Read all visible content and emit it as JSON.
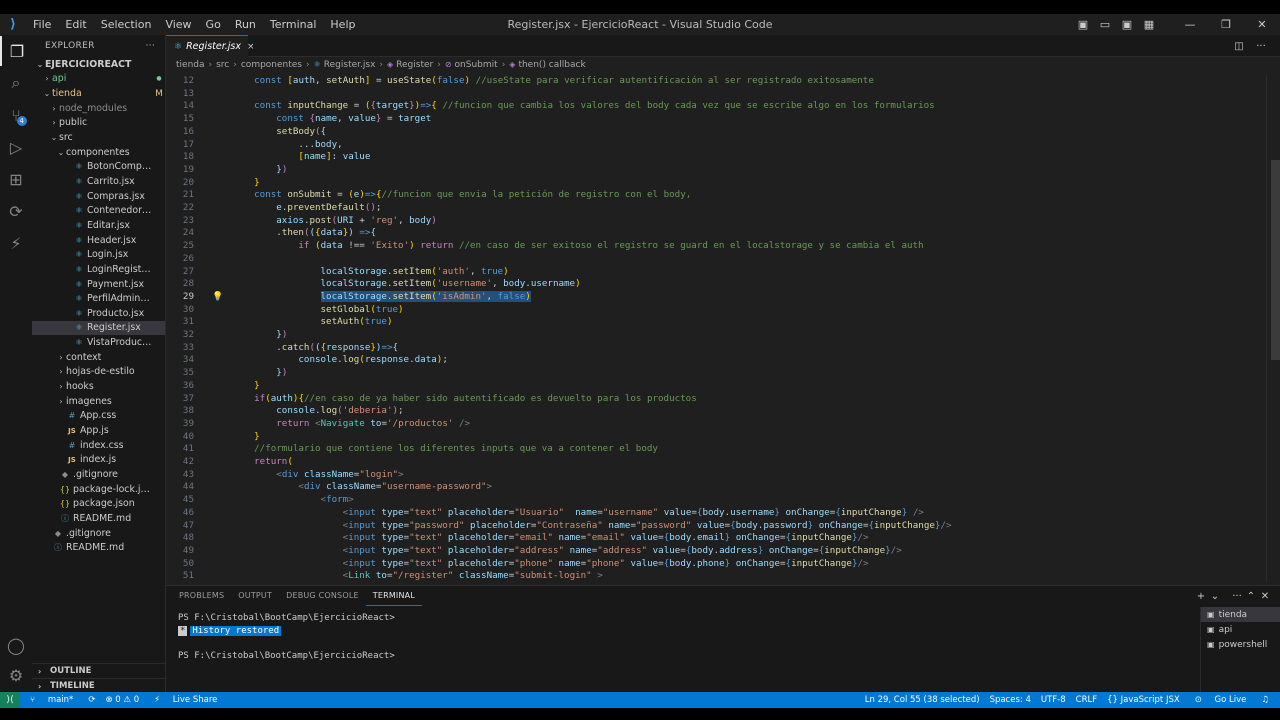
{
  "window": {
    "title": "Register.jsx - EjercicioReact - Visual Studio Code",
    "menu": [
      "File",
      "Edit",
      "Selection",
      "View",
      "Go",
      "Run",
      "Terminal",
      "Help"
    ]
  },
  "colors": {
    "accent": "#0078d4",
    "remote": "#16825d",
    "selection": "#264f78",
    "react_icon": "#4fc1e9"
  },
  "activity_bar": {
    "icons": [
      "explorer-icon",
      "search-icon",
      "source-control-icon",
      "run-debug-icon",
      "extensions-icon",
      "remote-explorer-icon",
      "live-share-icon",
      "accounts-icon",
      "manage-icon"
    ],
    "source_control_badge": "4"
  },
  "explorer": {
    "header": "EXPLORER",
    "more": "···",
    "tree": [
      {
        "label": "EJERCICIOREACT",
        "type": "root",
        "status": ""
      },
      {
        "label": "api",
        "type": "folder",
        "status": "●"
      },
      {
        "label": "tienda",
        "type": "folder-open",
        "status": "M"
      },
      {
        "label": "node_modules",
        "type": "folder",
        "status": ""
      },
      {
        "label": "public",
        "type": "folder",
        "status": ""
      },
      {
        "label": "src",
        "type": "folder-open",
        "status": ""
      },
      {
        "label": "componentes",
        "type": "folder-open",
        "status": ""
      },
      {
        "label": "BotonComprar.jsx",
        "type": "react",
        "status": ""
      },
      {
        "label": "Carrito.jsx",
        "type": "react",
        "status": ""
      },
      {
        "label": "Compras.jsx",
        "type": "react",
        "status": ""
      },
      {
        "label": "ContenedorProductos.j...",
        "type": "react",
        "status": ""
      },
      {
        "label": "Editar.jsx",
        "type": "react",
        "status": ""
      },
      {
        "label": "Header.jsx",
        "type": "react",
        "status": ""
      },
      {
        "label": "Login.jsx",
        "type": "react",
        "status": ""
      },
      {
        "label": "LoginRegisterProfile.jsx",
        "type": "react",
        "status": ""
      },
      {
        "label": "Payment.jsx",
        "type": "react",
        "status": ""
      },
      {
        "label": "PerfilAdmin.jsx",
        "type": "react",
        "status": ""
      },
      {
        "label": "Producto.jsx",
        "type": "react",
        "status": ""
      },
      {
        "label": "Register.jsx",
        "type": "react",
        "status": ""
      },
      {
        "label": "VistaProducto.jsx",
        "type": "react",
        "status": ""
      },
      {
        "label": "context",
        "type": "folder",
        "status": ""
      },
      {
        "label": "hojas-de-estilo",
        "type": "folder",
        "status": ""
      },
      {
        "label": "hooks",
        "type": "folder",
        "status": ""
      },
      {
        "label": "imagenes",
        "type": "folder",
        "status": ""
      },
      {
        "label": "App.css",
        "type": "css",
        "status": ""
      },
      {
        "label": "App.js",
        "type": "js",
        "status": ""
      },
      {
        "label": "index.css",
        "type": "css",
        "status": ""
      },
      {
        "label": "index.js",
        "type": "js",
        "status": ""
      },
      {
        "label": ".gitignore",
        "type": "git",
        "status": ""
      },
      {
        "label": "package-lock.json",
        "type": "json",
        "status": ""
      },
      {
        "label": "package.json",
        "type": "json",
        "status": ""
      },
      {
        "label": "README.md",
        "type": "info",
        "status": ""
      },
      {
        "label": ".gitignore",
        "type": "git",
        "status": ""
      },
      {
        "label": "README.md",
        "type": "info",
        "status": ""
      }
    ],
    "outline": "OUTLINE",
    "timeline": "TIMELINE"
  },
  "editor": {
    "tab": {
      "label": "Register.jsx",
      "close": "×"
    },
    "breadcrumb": [
      "tienda",
      "src",
      "componentes",
      "Register.jsx",
      "Register",
      "onSubmit",
      "then() callback"
    ],
    "current_line": "29"
  },
  "panel": {
    "tabs": [
      "PROBLEMS",
      "OUTPUT",
      "DEBUG CONSOLE",
      "TERMINAL"
    ],
    "active_tab": "TERMINAL",
    "terminal": {
      "prompt1": "PS F:\\Cristobal\\BootCamp\\EjercicioReact>",
      "history_mark": "*",
      "history": "History restored",
      "prompt2": "PS F:\\Cristobal\\BootCamp\\EjercicioReact>"
    },
    "terminals": [
      "tienda",
      "api",
      "powershell"
    ]
  },
  "status_bar": {
    "branch": "main*",
    "problems": "⊗ 0 ⚠ 0",
    "live_share": "Live Share",
    "cursor": "Ln 29, Col 55 (38 selected)",
    "spaces": "Spaces: 4",
    "encoding": "UTF-8",
    "eol": "CRLF",
    "language": "{} JavaScript JSX",
    "go_live": "Go Live"
  }
}
